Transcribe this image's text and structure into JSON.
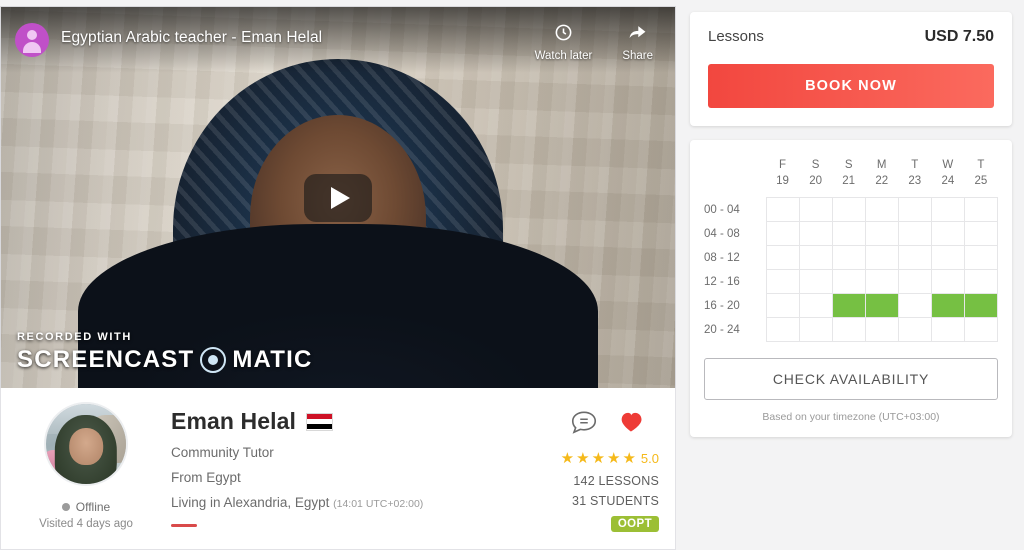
{
  "video": {
    "title": "Egyptian Arabic teacher - Eman Helal",
    "watch_later_label": "Watch later",
    "share_label": "Share",
    "watermark_top": "RECORDED WITH",
    "watermark_brand_left": "SCREENCAST",
    "watermark_brand_right": "MATIC"
  },
  "profile": {
    "name": "Eman Helal",
    "flag": "egypt-flag",
    "role": "Community Tutor",
    "from": "From Egypt",
    "living": "Living in Alexandria, Egypt",
    "local_time": "(14:01 UTC+02:00)",
    "status": "Offline",
    "visited": "Visited 4 days ago",
    "rating": "5.0",
    "stars": 5,
    "lessons": "142 LESSONS",
    "students": "31 STUDENTS",
    "badge": "OOPT"
  },
  "booking": {
    "lessons_label": "Lessons",
    "price": "USD 7.50",
    "book_button": "BOOK NOW"
  },
  "availability": {
    "days": [
      {
        "dow": "F",
        "date": "19"
      },
      {
        "dow": "S",
        "date": "20"
      },
      {
        "dow": "S",
        "date": "21"
      },
      {
        "dow": "M",
        "date": "22"
      },
      {
        "dow": "T",
        "date": "23"
      },
      {
        "dow": "W",
        "date": "24"
      },
      {
        "dow": "T",
        "date": "25"
      }
    ],
    "slots": [
      "00 - 04",
      "04 - 08",
      "08 - 12",
      "12 - 16",
      "16 - 20",
      "20 - 24"
    ],
    "grid": [
      [
        0,
        0,
        0,
        0,
        0,
        0,
        0
      ],
      [
        0,
        0,
        0,
        0,
        0,
        0,
        0
      ],
      [
        0,
        0,
        0,
        0,
        0,
        0,
        0
      ],
      [
        0,
        0,
        0,
        0,
        0,
        0,
        0
      ],
      [
        0,
        0,
        1,
        1,
        0,
        1,
        1
      ],
      [
        0,
        0,
        0,
        0,
        0,
        0,
        0
      ]
    ],
    "check_button": "CHECK AVAILABILITY",
    "timezone_note": "Based on your timezone (UTC+03:00)",
    "available_color": "#76c043"
  }
}
